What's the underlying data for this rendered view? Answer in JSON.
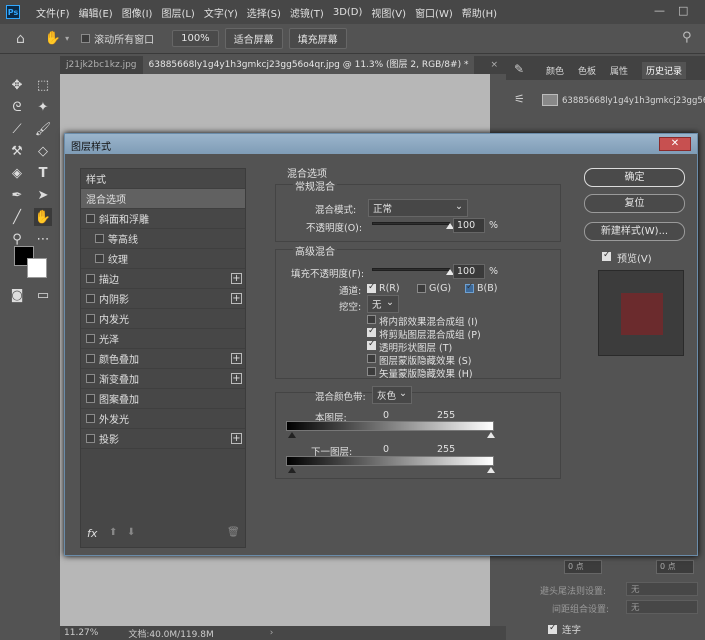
{
  "app": {
    "logo": "Ps",
    "menu": [
      "文件(F)",
      "编辑(E)",
      "图像(I)",
      "图层(L)",
      "文字(Y)",
      "选择(S)",
      "滤镜(T)",
      "3D(D)",
      "视图(V)",
      "窗口(W)",
      "帮助(H)"
    ]
  },
  "options_bar": {
    "scroll_all_label": "滚动所有窗口",
    "zoom_value": "100%",
    "fit_screen": "适合屏幕",
    "fill_screen": "填充屏幕"
  },
  "tabs": [
    {
      "label": "j21jk2bc1kz.jpg"
    },
    {
      "label": "63885668ly1g4y1h3gmkcj23gg56o4qr.jpg @ 11.3% (图层 2, RGB/8#) *"
    }
  ],
  "status": {
    "zoom": "11.27%",
    "doc": "文档:40.0M/119.8M"
  },
  "right_panel": {
    "tabs": [
      "颜色",
      "色板",
      "属性",
      "历史记录"
    ],
    "history_item": "63885668ly1g4y1h3gmkcj23gg56",
    "field1": "0 点",
    "field2": "0 点",
    "row1_label": "避头尾法则设置:",
    "row1_value": "无",
    "row2_label": "间距组合设置:",
    "row2_value": "无",
    "liga_label": "连字"
  },
  "dialog": {
    "title": "图层样式",
    "styles_header": "样式",
    "styles": [
      {
        "label": "混合选项",
        "checkbox": false,
        "plus": false,
        "active": true,
        "indent": false
      },
      {
        "label": "斜面和浮雕",
        "checkbox": true,
        "plus": false,
        "active": false,
        "indent": false
      },
      {
        "label": "等高线",
        "checkbox": true,
        "plus": false,
        "active": false,
        "indent": true
      },
      {
        "label": "纹理",
        "checkbox": true,
        "plus": false,
        "active": false,
        "indent": true
      },
      {
        "label": "描边",
        "checkbox": true,
        "plus": true,
        "active": false,
        "indent": false
      },
      {
        "label": "内阴影",
        "checkbox": true,
        "plus": true,
        "active": false,
        "indent": false
      },
      {
        "label": "内发光",
        "checkbox": true,
        "plus": false,
        "active": false,
        "indent": false
      },
      {
        "label": "光泽",
        "checkbox": true,
        "plus": false,
        "active": false,
        "indent": false
      },
      {
        "label": "颜色叠加",
        "checkbox": true,
        "plus": true,
        "active": false,
        "indent": false
      },
      {
        "label": "渐变叠加",
        "checkbox": true,
        "plus": true,
        "active": false,
        "indent": false
      },
      {
        "label": "图案叠加",
        "checkbox": true,
        "plus": false,
        "active": false,
        "indent": false
      },
      {
        "label": "外发光",
        "checkbox": true,
        "plus": false,
        "active": false,
        "indent": false
      },
      {
        "label": "投影",
        "checkbox": true,
        "plus": true,
        "active": false,
        "indent": false
      }
    ],
    "fx_label": "fx",
    "section_title": "混合选项",
    "general": {
      "title": "常规混合",
      "mode_label": "混合模式:",
      "mode_value": "正常",
      "opacity_label": "不透明度(O):",
      "opacity_value": "100",
      "opacity_unit": "%",
      "opacity_level": 1.0
    },
    "advanced": {
      "title": "高级混合",
      "fill_label": "填充不透明度(F):",
      "fill_value": "100",
      "fill_unit": "%",
      "fill_level": 1.0,
      "channels_label": "通道:",
      "channel_r": "R(R)",
      "channel_g": "G(G)",
      "channel_b": "B(B)",
      "knockout_label": "挖空:",
      "knockout_value": "无",
      "options": [
        {
          "label": "将内部效果混合成组 (I)",
          "checked": false
        },
        {
          "label": "将剪贴图层混合成组 (P)",
          "checked": true
        },
        {
          "label": "透明形状图层 (T)",
          "checked": true
        },
        {
          "label": "图层蒙版隐藏效果 (S)",
          "checked": false
        },
        {
          "label": "矢量蒙版隐藏效果 (H)",
          "checked": false
        }
      ]
    },
    "blend_if": {
      "label": "混合颜色带:",
      "value": "灰色",
      "this_layer": "本图层:",
      "under_layer": "下一图层:",
      "min": "0",
      "max": "255"
    },
    "buttons": {
      "ok": "确定",
      "reset": "复位",
      "new_style": "新建样式(W)...",
      "preview": "预览(V)"
    },
    "preview_color": "#6b2b2d"
  }
}
